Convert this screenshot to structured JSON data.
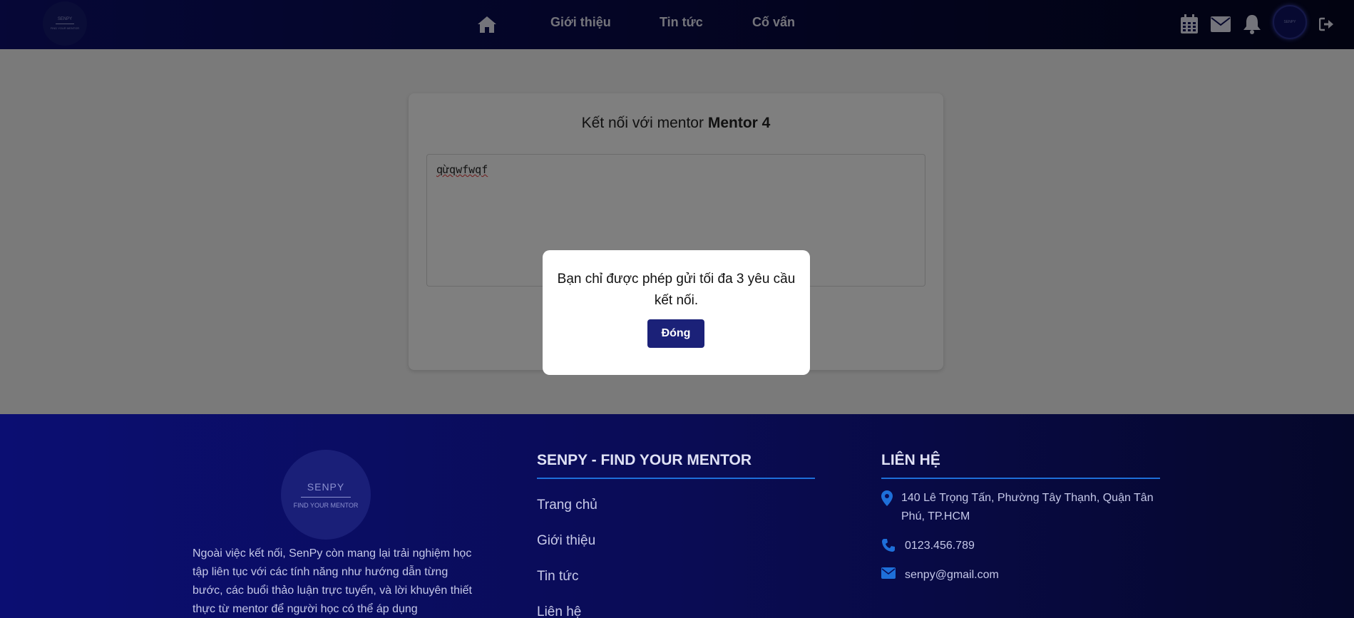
{
  "header": {
    "logo_text": "SENPY",
    "logo_sub": "FIND YOUR MENTOR",
    "nav": [
      "Giới thiệu",
      "Tin tức",
      "Cố vấn"
    ],
    "icons": [
      "home-icon",
      "calendar-icon",
      "mail-icon",
      "bell-icon",
      "avatar",
      "logout-icon"
    ]
  },
  "card": {
    "title_prefix": "Kết nối với mentor ",
    "mentor_name": "Mentor 4",
    "message_value": "qừqwfwqf"
  },
  "modal": {
    "message": "Bạn chỉ được phép gửi tối đa 3 yêu cầu kết nối.",
    "button": "Đóng"
  },
  "footer": {
    "logo_text": "SENPY",
    "logo_sub": "FIND YOUR MENTOR",
    "description": "Ngoài việc kết nối, SenPy còn mang lại trải nghiệm học tập liên tục với các tính năng như hướng dẫn từng bước, các buổi thảo luận trực tuyến, và lời khuyên thiết thực từ mentor để người học có thể áp dụng",
    "col1_title": "SENPY - FIND YOUR MENTOR",
    "links": [
      "Trang chủ",
      "Giới thiệu",
      "Tin tức",
      "Liên hệ"
    ],
    "col2_title": "LIÊN HỆ",
    "address": "140 Lê Trọng Tấn, Phường Tây Thạnh, Quận Tân Phú, TP.HCM",
    "phone": "0123.456.789",
    "email": "senpy@gmail.com"
  },
  "colors": {
    "header_bg": "#0c0f6e",
    "button_bg": "#1b2178",
    "accent_rule": "#1e6fd9"
  }
}
